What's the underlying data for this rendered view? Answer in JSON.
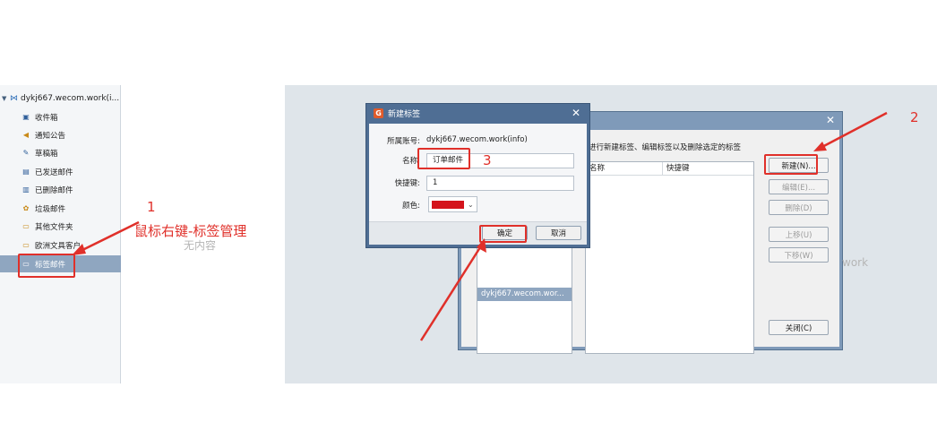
{
  "left_panel": {
    "account": "dykj667.wecom.work(i...",
    "folders": [
      {
        "label": "收件箱",
        "icon": "inbox-icon"
      },
      {
        "label": "通知公告",
        "icon": "megaphone-icon"
      },
      {
        "label": "草稿箱",
        "icon": "draft-icon"
      },
      {
        "label": "已发送邮件",
        "icon": "sent-icon"
      },
      {
        "label": "已删除邮件",
        "icon": "trash-icon"
      },
      {
        "label": "垃圾邮件",
        "icon": "spam-icon"
      },
      {
        "label": "其他文件夹",
        "icon": "folder-icon"
      },
      {
        "label": "欧洲文具客户",
        "icon": "folder-icon"
      },
      {
        "label": "标签邮件",
        "icon": "tag-folder-icon"
      }
    ],
    "empty_text": "无内容"
  },
  "annotations": {
    "step1_num": "1",
    "step1_text": "鼠标右键-标签管理",
    "step2_num": "2",
    "step3_num": "3",
    "color": "#e0302a"
  },
  "tag_manager": {
    "description": "进行新建标签、编辑标签以及删除选定的标签",
    "column_name": "名称",
    "column_shortcut": "快捷键",
    "account_item": "dykj667.wecom.wor...",
    "buttons": {
      "new": "新建(N)...",
      "edit": "编辑(E)...",
      "delete": "删除(D)",
      "move_up": "上移(U)",
      "move_down": "下移(W)",
      "close": "关闭(C)"
    },
    "work_text": "work"
  },
  "new_tag_dialog": {
    "title": "新建标签",
    "account_label": "所属账号:",
    "account_value": "dykj667.wecom.work(info)",
    "name_label": "名称:",
    "name_value": "订单邮件",
    "shortcut_label": "快捷键:",
    "shortcut_value": "1",
    "color_label": "颜色:",
    "color_value": "#d4141c",
    "ok": "确定",
    "cancel": "取消"
  }
}
